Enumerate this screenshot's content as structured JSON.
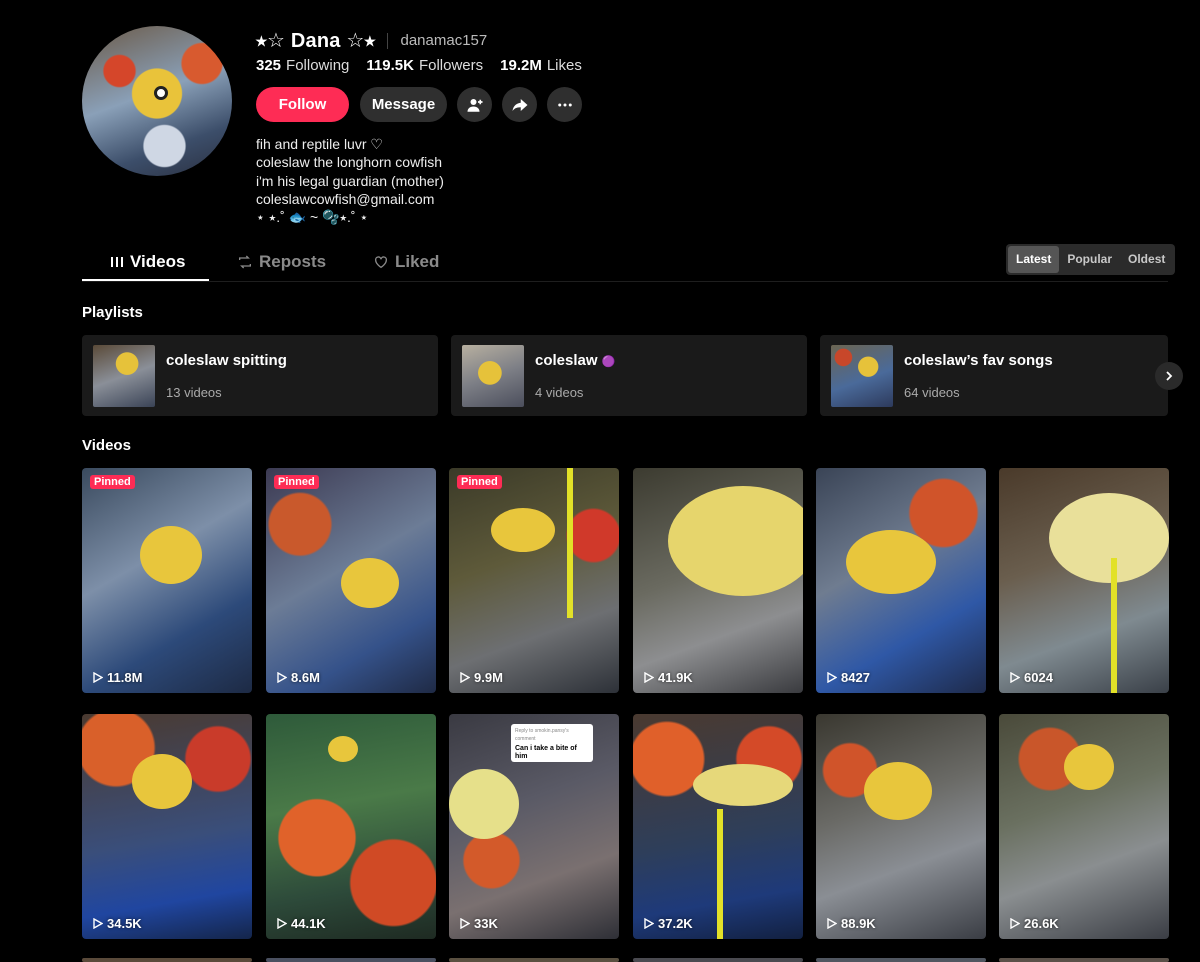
{
  "profile": {
    "display_name": "⭑☆ Dana ☆⭑",
    "username": "danamac157",
    "stats": {
      "following_count": "325",
      "following_label": "Following",
      "followers_count": "119.5K",
      "followers_label": "Followers",
      "likes_count": "19.2M",
      "likes_label": "Likes"
    },
    "follow_label": "Follow",
    "message_label": "Message",
    "bio": [
      "fih and reptile luvr ♡",
      "coleslaw the longhorn cowfish",
      "i'm his legal guardian (mother)",
      "coleslawcowfish@gmail.com",
      "⋆ ⭑.˚ 🐟 ~ 🫧⭑.˚ ⋆"
    ]
  },
  "tabs": {
    "videos": "Videos",
    "reposts": "Reposts",
    "liked": "Liked"
  },
  "sort": {
    "latest": "Latest",
    "popular": "Popular",
    "oldest": "Oldest",
    "selected": "Latest"
  },
  "playlists": {
    "title": "Playlists",
    "items": [
      {
        "title": "coleslaw spitting",
        "count": "13 videos"
      },
      {
        "title": "coleslaw",
        "badge": "🟣",
        "count": "4 videos"
      },
      {
        "title": "coleslaw’s fav songs",
        "count": "64 videos"
      }
    ]
  },
  "videos": {
    "title": "Videos",
    "pinned_label": "Pinned",
    "items": [
      {
        "views": "11.8M",
        "pinned": true
      },
      {
        "views": "8.6M",
        "pinned": true
      },
      {
        "views": "9.9M",
        "pinned": true
      },
      {
        "views": "41.9K",
        "pinned": false
      },
      {
        "views": "8427",
        "pinned": false
      },
      {
        "views": "6024",
        "pinned": false
      },
      {
        "views": "34.5K",
        "pinned": false
      },
      {
        "views": "44.1K",
        "pinned": false
      },
      {
        "views": "33K",
        "pinned": false,
        "comment_header": "Reply to smokin.pansy's comment",
        "comment_text": "Can i take a bite of him"
      },
      {
        "views": "37.2K",
        "pinned": false
      },
      {
        "views": "88.9K",
        "pinned": false
      },
      {
        "views": "26.6K",
        "pinned": false
      }
    ]
  },
  "colors": {
    "accent": "#fe2c55",
    "background": "#000000",
    "button_dark": "#2f2f2f"
  },
  "icons": [
    "add-friend-icon",
    "share-icon",
    "more-icon",
    "videos-grid-icon",
    "repost-icon",
    "liked-icon",
    "chevron-right-icon",
    "play-icon"
  ]
}
